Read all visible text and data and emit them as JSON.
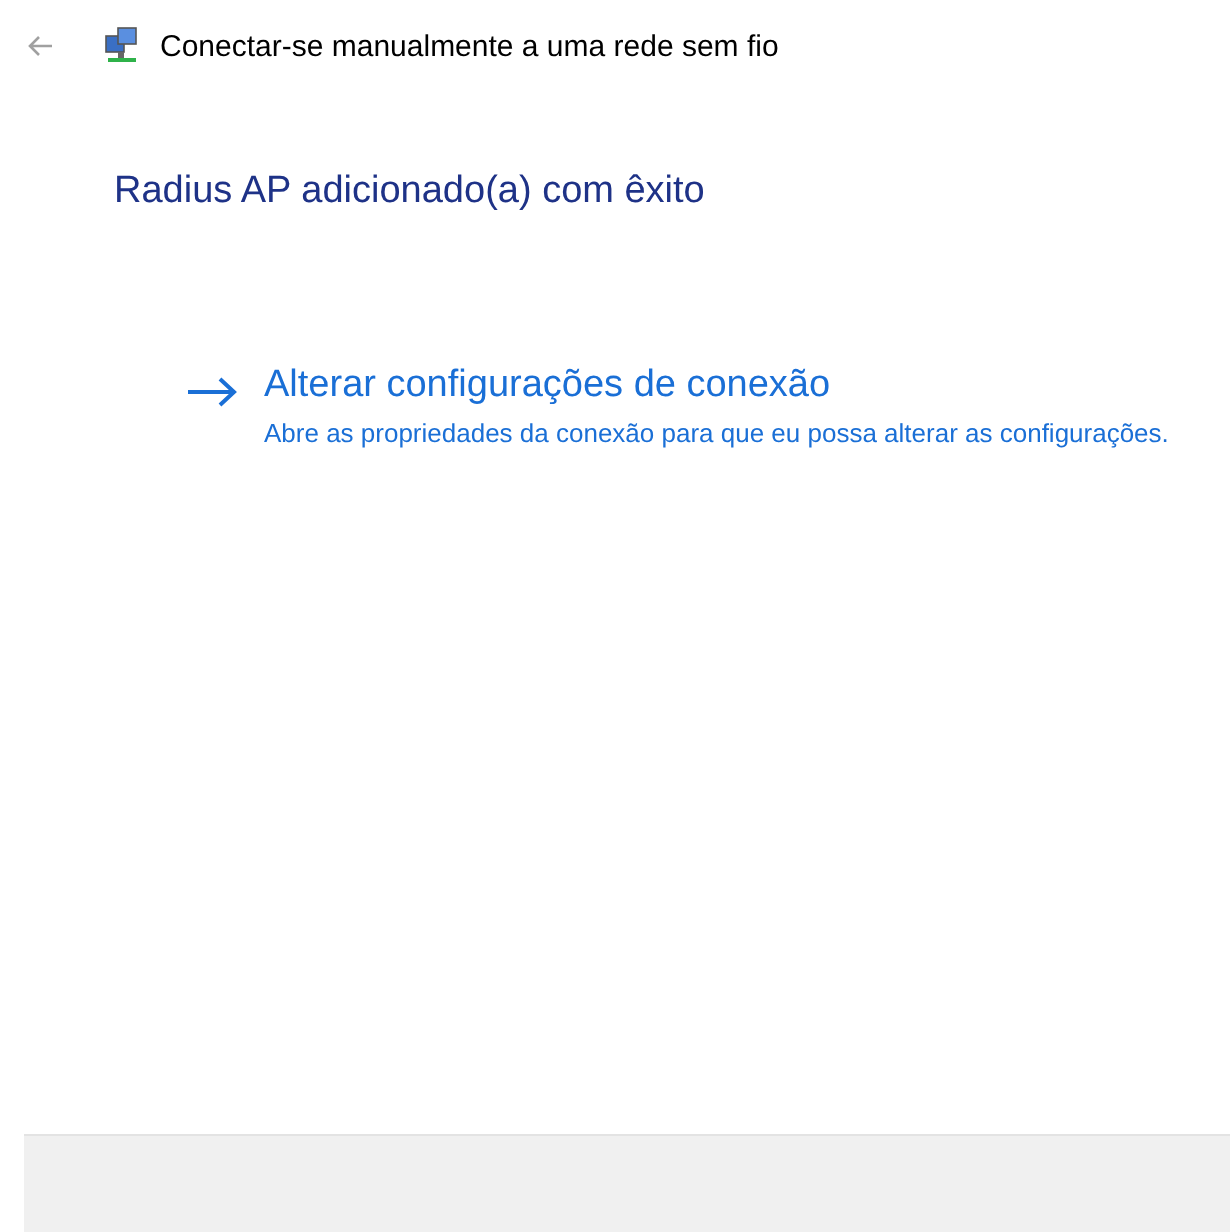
{
  "window": {
    "title": "Conectar-se manualmente a uma rede sem fio"
  },
  "heading": "Radius AP adicionado(a) com êxito",
  "option": {
    "title": "Alterar configurações de conexão",
    "description": "Abre as propriedades da conexão para que eu possa alterar as configurações."
  }
}
